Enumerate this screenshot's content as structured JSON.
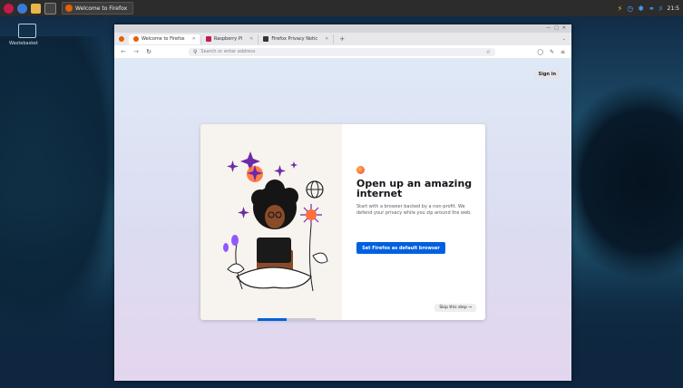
{
  "taskbar": {
    "task_label": "Welcome to Firefox",
    "clock": "21:5"
  },
  "desktop": {
    "icon_label": "Wastebasket"
  },
  "browser": {
    "tabs": [
      {
        "label": "Welcome to Firefox",
        "fav_color": "#e66000",
        "active": true
      },
      {
        "label": "Raspberry Pi",
        "fav_color": "#c51a4a",
        "active": false
      },
      {
        "label": "Firefox Privacy Notic",
        "fav_color": "#333333",
        "active": false
      }
    ],
    "url_placeholder": "Search or enter address"
  },
  "page": {
    "sign_in": "Sign in",
    "headline": "Open up an amazing internet",
    "description": "Start with a browser backed by a non-profit. We defend your privacy while you zip around the web.",
    "primary_button": "Set Firefox as default browser",
    "skip_button": "Skip this step →"
  },
  "colors": {
    "accent": "#0061e0",
    "taskbar": "#2c2c2c"
  }
}
